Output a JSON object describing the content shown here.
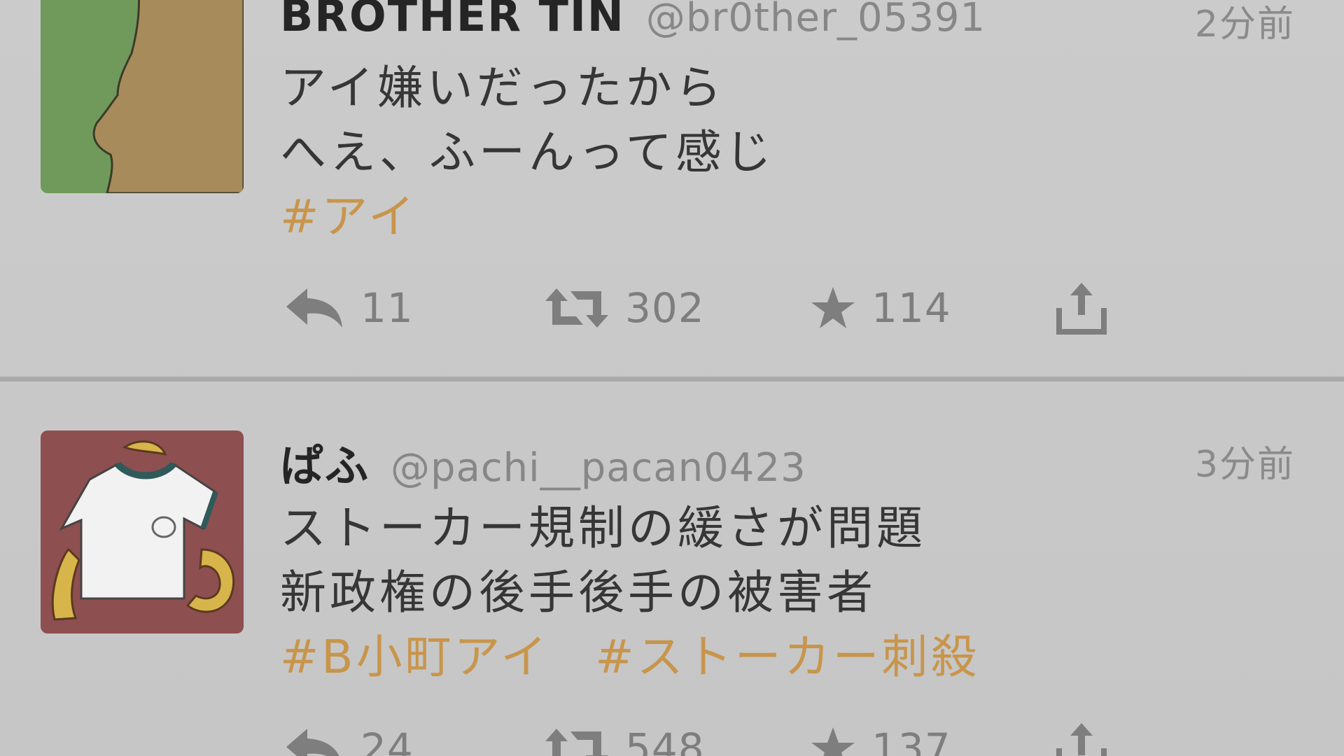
{
  "tweets": [
    {
      "display_name": "BROTHER TIN",
      "handle": "@br0ther_05391",
      "time": "2分前",
      "lines": [
        "アイ嫌いだったから",
        "へえ、ふーんって感じ"
      ],
      "hashtags": [
        "#アイ"
      ],
      "replies": "11",
      "retweets": "302",
      "favorites": "114",
      "avatar_icon": "silhouette-profile-avatar"
    },
    {
      "display_name": "ぱふ",
      "handle": "@pachi__pacan0423",
      "time": "3分前",
      "lines": [
        "ストーカー規制の緩さが問題",
        "新政権の後手後手の被害者"
      ],
      "hashtags": [
        "#B小町アイ",
        "#ストーカー刺殺"
      ],
      "replies": "24",
      "retweets": "548",
      "favorites": "137",
      "avatar_icon": "gym-shirt-avatar"
    }
  ],
  "colors": {
    "background": "#c9c9c9",
    "hashtag": "#c8954b",
    "name": "#252525",
    "muted": "#878787",
    "divider": "#a9a9a9"
  },
  "icons": {
    "reply": "reply-icon",
    "retweet": "retweet-icon",
    "favorite": "star-icon",
    "share": "share-icon"
  }
}
